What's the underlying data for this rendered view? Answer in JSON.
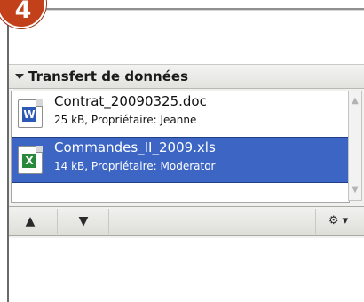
{
  "step_badge": "4",
  "panel": {
    "title": "Transfert de données",
    "files": [
      {
        "name": "Contrat_20090325.doc",
        "meta": "25 kB, Propriétaire: Jeanne",
        "icon": "word-document-icon",
        "selected": false
      },
      {
        "name": "Commandes_II_2009.xls",
        "meta": "14 kB, Propriétaire: Moderator",
        "icon": "excel-spreadsheet-icon",
        "selected": true
      }
    ]
  },
  "toolbar": {
    "move_up_glyph": "▲",
    "move_down_glyph": "▼",
    "options_glyph": "⚙ ▾"
  },
  "colors": {
    "badge": "#c2401a",
    "selection": "#3d66c4"
  }
}
